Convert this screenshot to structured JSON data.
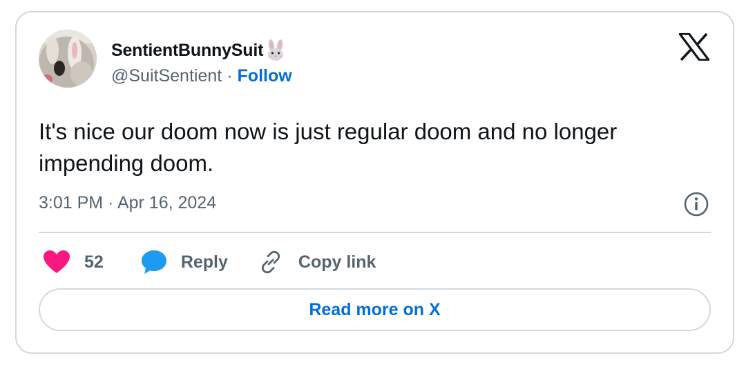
{
  "author": {
    "display_name": "SentientBunnySuit",
    "name_emoji": "rabbit-face-emoji",
    "handle": "@SuitSentient",
    "separator": "·",
    "follow_label": "Follow"
  },
  "tweet": {
    "text": "It's nice our doom now is just regular doom and no longer impending doom.",
    "timestamp": "3:01 PM · Apr 16, 2024"
  },
  "actions": {
    "like_count": "52",
    "reply_label": "Reply",
    "copy_link_label": "Copy link"
  },
  "read_more_label": "Read more on X",
  "icons": {
    "brand": "x-logo-icon",
    "info": "info-icon",
    "like": "heart-icon",
    "reply": "speech-bubble-icon",
    "copy": "link-icon"
  },
  "colors": {
    "text_primary": "#0f1419",
    "text_secondary": "#536471",
    "link_blue": "#006fd6",
    "heart": "#f91880",
    "reply_bubble": "#1d9bf0",
    "border": "#cfd9de"
  }
}
